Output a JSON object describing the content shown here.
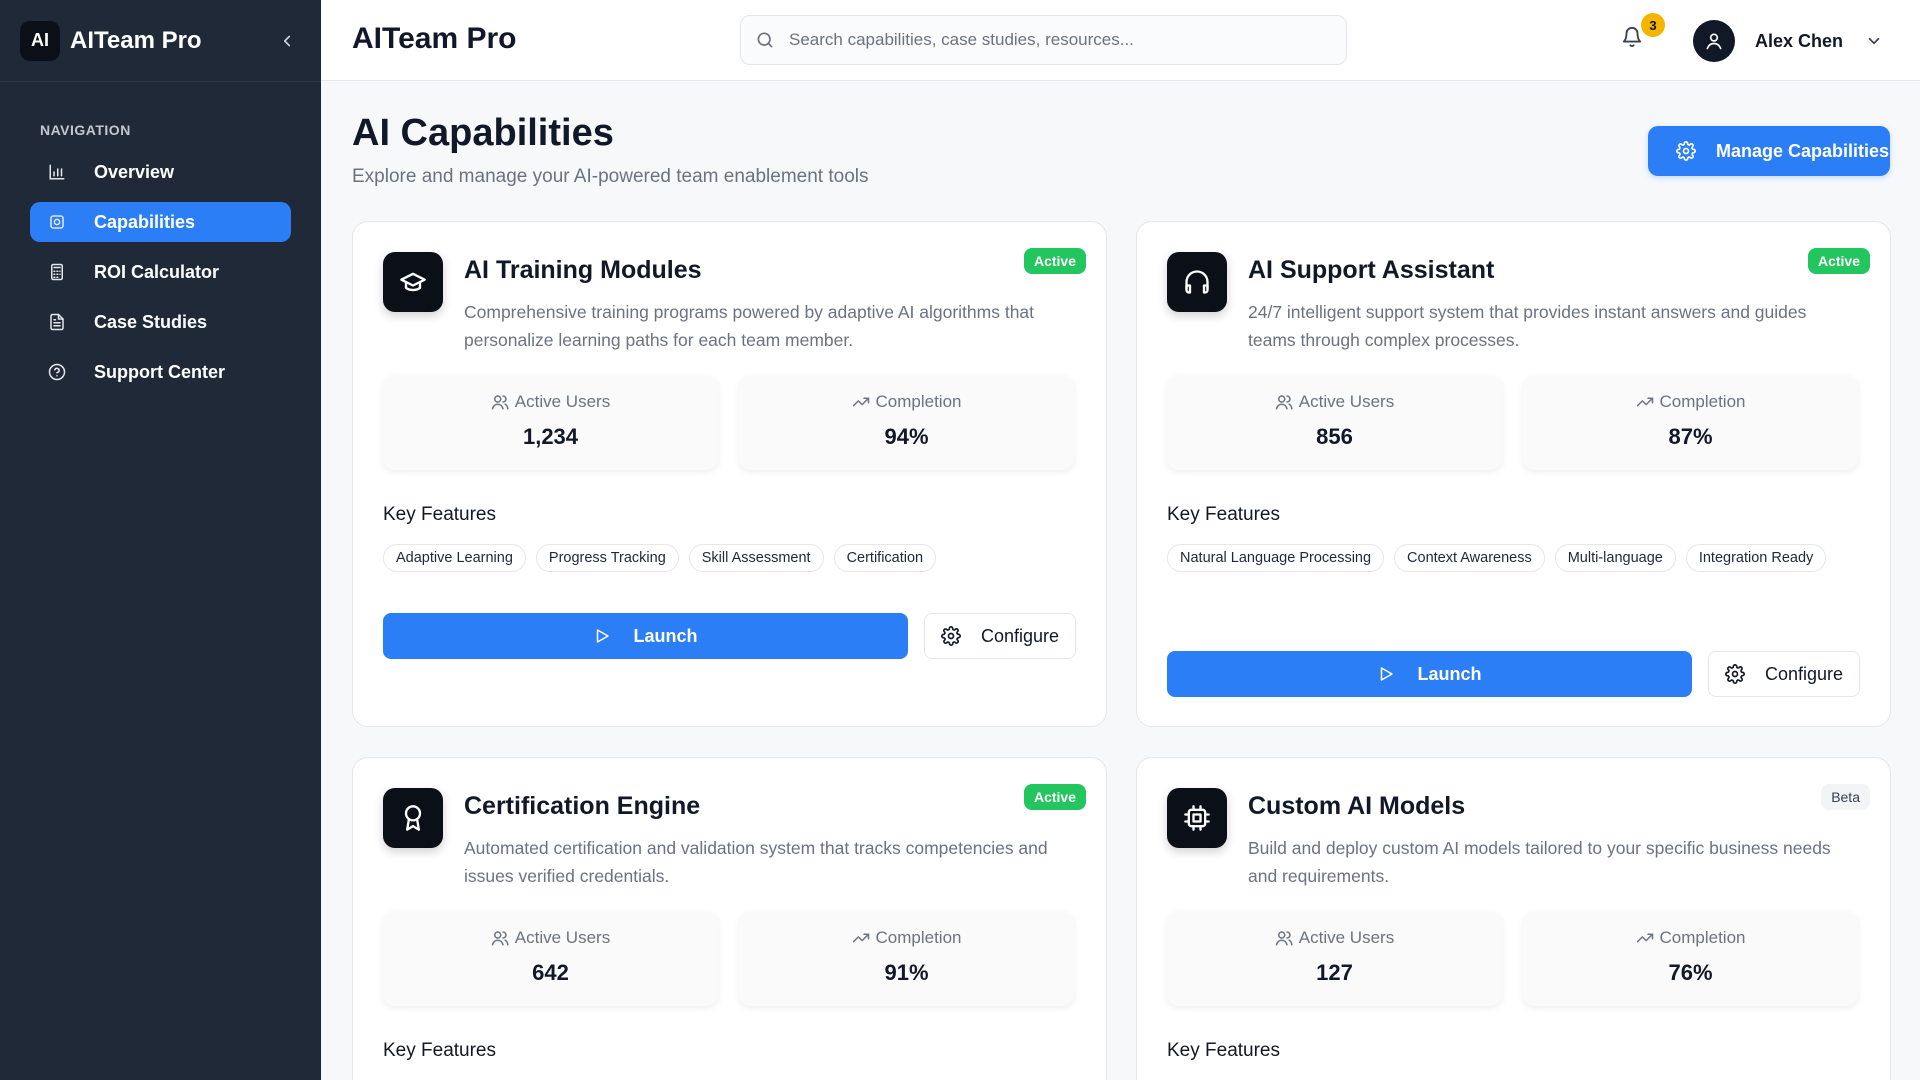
{
  "app": {
    "logo_text": "AI",
    "name": "AITeam Pro"
  },
  "sidebar": {
    "heading": "NAVIGATION",
    "items": [
      {
        "label": "Overview",
        "icon": "bar-chart-icon",
        "active": false
      },
      {
        "label": "Capabilities",
        "icon": "settings-icon",
        "active": true
      },
      {
        "label": "ROI Calculator",
        "icon": "calculator-icon",
        "active": false
      },
      {
        "label": "Case Studies",
        "icon": "document-icon",
        "active": false
      },
      {
        "label": "Support Center",
        "icon": "help-circle-icon",
        "active": false
      }
    ]
  },
  "header": {
    "title": "AITeam Pro",
    "search_placeholder": "Search capabilities, case studies, resources...",
    "notifications_count": "3",
    "user_name": "Alex Chen"
  },
  "page": {
    "title": "AI Capabilities",
    "subtitle": "Explore and manage your AI-powered team enablement tools",
    "manage_button": "Manage Capabilities"
  },
  "labels": {
    "active_users": "Active Users",
    "completion": "Completion",
    "key_features": "Key Features",
    "launch": "Launch",
    "configure": "Configure"
  },
  "cards": [
    {
      "title": "AI Training Modules",
      "status": "Active",
      "icon": "graduation-cap-icon",
      "description": "Comprehensive training programs powered by adaptive AI algorithms that personalize learning paths for each team member.",
      "active_users": "1,234",
      "completion": "94%",
      "features": [
        "Adaptive Learning",
        "Progress Tracking",
        "Skill Assessment",
        "Certification"
      ]
    },
    {
      "title": "AI Support Assistant",
      "status": "Active",
      "icon": "headphones-icon",
      "description": "24/7 intelligent support system that provides instant answers and guides teams through complex processes.",
      "active_users": "856",
      "completion": "87%",
      "features": [
        "Natural Language Processing",
        "Context Awareness",
        "Multi-language",
        "Integration Ready"
      ]
    },
    {
      "title": "Certification Engine",
      "status": "Active",
      "icon": "award-icon",
      "description": "Automated certification and validation system that tracks competencies and issues verified credentials.",
      "active_users": "642",
      "completion": "91%"
    },
    {
      "title": "Custom AI Models",
      "status": "Beta",
      "icon": "cpu-icon",
      "description": "Build and deploy custom AI models tailored to your specific business needs and requirements.",
      "active_users": "127",
      "completion": "76%"
    }
  ],
  "colors": {
    "accent": "#2b7ef5",
    "sidebar": "#1f2937",
    "active_badge": "#22c55e",
    "notification_badge": "#f5b400"
  }
}
